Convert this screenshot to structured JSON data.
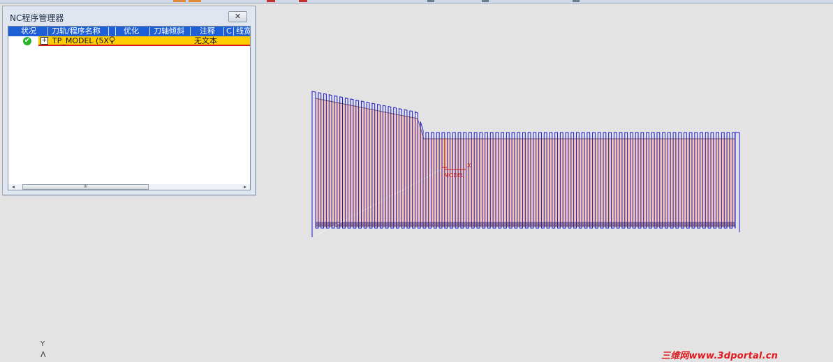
{
  "dialog": {
    "title": "NC程序管理器",
    "close_label": "✕",
    "columns": [
      "状况",
      "刀轨/程序名称",
      "优化",
      "刀轴倾斜",
      "注释",
      "C",
      "线宽"
    ],
    "row": {
      "name": "TP_MODEL (5X",
      "comment": "无文本",
      "status_icon": "green-check-icon",
      "expand_symbol": "+"
    },
    "scroll": {
      "left_arrow": "◂",
      "right_arrow": "▸",
      "thumb_grip": "III"
    }
  },
  "viewport": {
    "model_label": "MODEL",
    "x_axis_label": "X",
    "view_axis_label": "Y",
    "view_axis_glyph": "Λ"
  },
  "watermark": "三维网www.3dportal.cn",
  "colors": {
    "header_blue": "#1f5fd6",
    "row_highlight": "#ffcc00",
    "row_underline": "#d81818",
    "toolpath_blue": "#1a1acc",
    "model_fill": "#f6c7a8",
    "datum_red": "#c62020",
    "watermark_red": "#e0191f"
  }
}
